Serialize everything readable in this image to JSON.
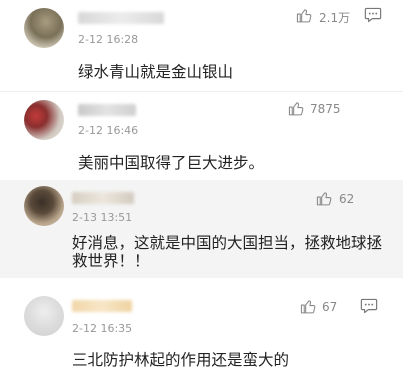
{
  "comments": [
    {
      "time": "2-12 16:28",
      "likes": "2.1万",
      "text_lines": [
        "绿水青山就是金山银山"
      ],
      "has_reply": true
    },
    {
      "time": "2-12 16:46",
      "likes": "7875",
      "text_lines": [
        "美丽中国取得了巨大进步。"
      ],
      "has_reply": false
    },
    {
      "time": "2-13 13:51",
      "likes": "62",
      "text_lines": [
        "好消息，这就是中国的大国担当，拯救地球拯",
        "救世界！！"
      ],
      "has_reply": false,
      "highlighted": true
    },
    {
      "time": "2-12 16:35",
      "likes": "67",
      "text_lines": [
        "三北防护林起的作用还是蛮大的"
      ],
      "has_reply": true
    }
  ],
  "icons": {
    "like": "thumbs-up-icon",
    "reply": "comment-bubble-icon"
  },
  "colors": {
    "meta_text": "#999999",
    "highlight_bg": "#f4f4f4"
  }
}
